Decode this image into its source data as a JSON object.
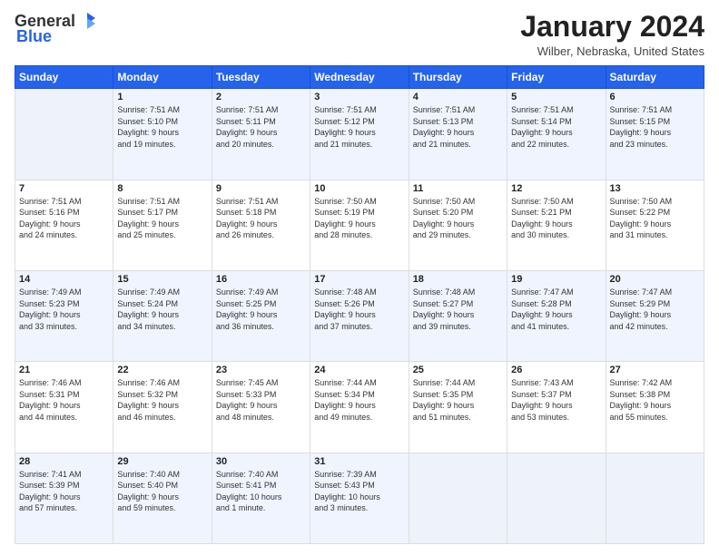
{
  "app": {
    "logo_general": "General",
    "logo_blue": "Blue"
  },
  "header": {
    "month_title": "January 2024",
    "location": "Wilber, Nebraska, United States"
  },
  "days_of_week": [
    "Sunday",
    "Monday",
    "Tuesday",
    "Wednesday",
    "Thursday",
    "Friday",
    "Saturday"
  ],
  "weeks": [
    [
      {
        "day": "",
        "info": ""
      },
      {
        "day": "1",
        "info": "Sunrise: 7:51 AM\nSunset: 5:10 PM\nDaylight: 9 hours\nand 19 minutes."
      },
      {
        "day": "2",
        "info": "Sunrise: 7:51 AM\nSunset: 5:11 PM\nDaylight: 9 hours\nand 20 minutes."
      },
      {
        "day": "3",
        "info": "Sunrise: 7:51 AM\nSunset: 5:12 PM\nDaylight: 9 hours\nand 21 minutes."
      },
      {
        "day": "4",
        "info": "Sunrise: 7:51 AM\nSunset: 5:13 PM\nDaylight: 9 hours\nand 21 minutes."
      },
      {
        "day": "5",
        "info": "Sunrise: 7:51 AM\nSunset: 5:14 PM\nDaylight: 9 hours\nand 22 minutes."
      },
      {
        "day": "6",
        "info": "Sunrise: 7:51 AM\nSunset: 5:15 PM\nDaylight: 9 hours\nand 23 minutes."
      }
    ],
    [
      {
        "day": "7",
        "info": "Sunrise: 7:51 AM\nSunset: 5:16 PM\nDaylight: 9 hours\nand 24 minutes."
      },
      {
        "day": "8",
        "info": "Sunrise: 7:51 AM\nSunset: 5:17 PM\nDaylight: 9 hours\nand 25 minutes."
      },
      {
        "day": "9",
        "info": "Sunrise: 7:51 AM\nSunset: 5:18 PM\nDaylight: 9 hours\nand 26 minutes."
      },
      {
        "day": "10",
        "info": "Sunrise: 7:50 AM\nSunset: 5:19 PM\nDaylight: 9 hours\nand 28 minutes."
      },
      {
        "day": "11",
        "info": "Sunrise: 7:50 AM\nSunset: 5:20 PM\nDaylight: 9 hours\nand 29 minutes."
      },
      {
        "day": "12",
        "info": "Sunrise: 7:50 AM\nSunset: 5:21 PM\nDaylight: 9 hours\nand 30 minutes."
      },
      {
        "day": "13",
        "info": "Sunrise: 7:50 AM\nSunset: 5:22 PM\nDaylight: 9 hours\nand 31 minutes."
      }
    ],
    [
      {
        "day": "14",
        "info": "Sunrise: 7:49 AM\nSunset: 5:23 PM\nDaylight: 9 hours\nand 33 minutes."
      },
      {
        "day": "15",
        "info": "Sunrise: 7:49 AM\nSunset: 5:24 PM\nDaylight: 9 hours\nand 34 minutes."
      },
      {
        "day": "16",
        "info": "Sunrise: 7:49 AM\nSunset: 5:25 PM\nDaylight: 9 hours\nand 36 minutes."
      },
      {
        "day": "17",
        "info": "Sunrise: 7:48 AM\nSunset: 5:26 PM\nDaylight: 9 hours\nand 37 minutes."
      },
      {
        "day": "18",
        "info": "Sunrise: 7:48 AM\nSunset: 5:27 PM\nDaylight: 9 hours\nand 39 minutes."
      },
      {
        "day": "19",
        "info": "Sunrise: 7:47 AM\nSunset: 5:28 PM\nDaylight: 9 hours\nand 41 minutes."
      },
      {
        "day": "20",
        "info": "Sunrise: 7:47 AM\nSunset: 5:29 PM\nDaylight: 9 hours\nand 42 minutes."
      }
    ],
    [
      {
        "day": "21",
        "info": "Sunrise: 7:46 AM\nSunset: 5:31 PM\nDaylight: 9 hours\nand 44 minutes."
      },
      {
        "day": "22",
        "info": "Sunrise: 7:46 AM\nSunset: 5:32 PM\nDaylight: 9 hours\nand 46 minutes."
      },
      {
        "day": "23",
        "info": "Sunrise: 7:45 AM\nSunset: 5:33 PM\nDaylight: 9 hours\nand 48 minutes."
      },
      {
        "day": "24",
        "info": "Sunrise: 7:44 AM\nSunset: 5:34 PM\nDaylight: 9 hours\nand 49 minutes."
      },
      {
        "day": "25",
        "info": "Sunrise: 7:44 AM\nSunset: 5:35 PM\nDaylight: 9 hours\nand 51 minutes."
      },
      {
        "day": "26",
        "info": "Sunrise: 7:43 AM\nSunset: 5:37 PM\nDaylight: 9 hours\nand 53 minutes."
      },
      {
        "day": "27",
        "info": "Sunrise: 7:42 AM\nSunset: 5:38 PM\nDaylight: 9 hours\nand 55 minutes."
      }
    ],
    [
      {
        "day": "28",
        "info": "Sunrise: 7:41 AM\nSunset: 5:39 PM\nDaylight: 9 hours\nand 57 minutes."
      },
      {
        "day": "29",
        "info": "Sunrise: 7:40 AM\nSunset: 5:40 PM\nDaylight: 9 hours\nand 59 minutes."
      },
      {
        "day": "30",
        "info": "Sunrise: 7:40 AM\nSunset: 5:41 PM\nDaylight: 10 hours\nand 1 minute."
      },
      {
        "day": "31",
        "info": "Sunrise: 7:39 AM\nSunset: 5:43 PM\nDaylight: 10 hours\nand 3 minutes."
      },
      {
        "day": "",
        "info": ""
      },
      {
        "day": "",
        "info": ""
      },
      {
        "day": "",
        "info": ""
      }
    ]
  ]
}
